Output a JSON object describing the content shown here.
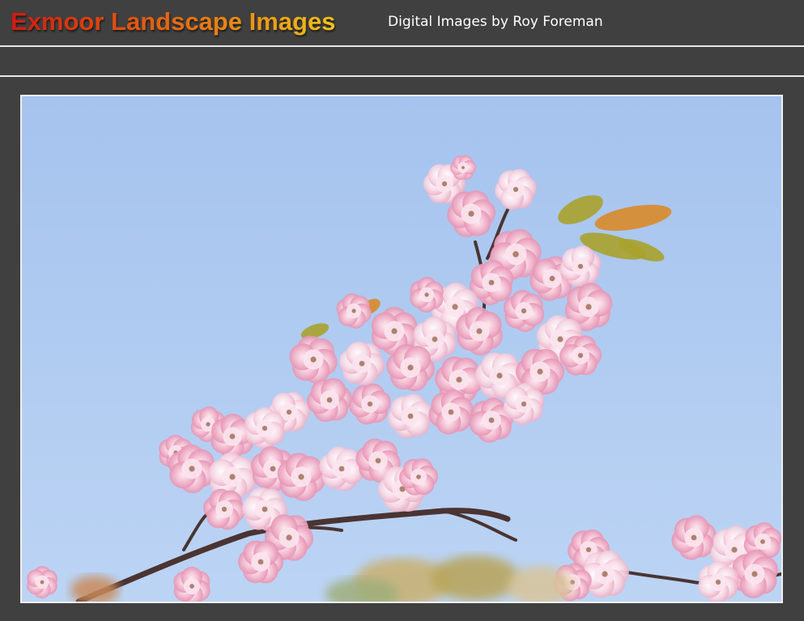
{
  "header": {
    "site_title": "Exmoor Landscape Images",
    "tagline": "Digital Images by Roy Foreman"
  },
  "photo": {
    "subject": "pink-cherry-blossom-branch",
    "colors": {
      "sky": "#a9c7f0",
      "blossom": "#f3b7cc",
      "blossom_light": "#fbe6ee",
      "blossom_dark": "#dd7fa3",
      "leaf": "#a8a22c",
      "leaf_orange": "#d98a2a",
      "branch": "#4a3432"
    }
  }
}
